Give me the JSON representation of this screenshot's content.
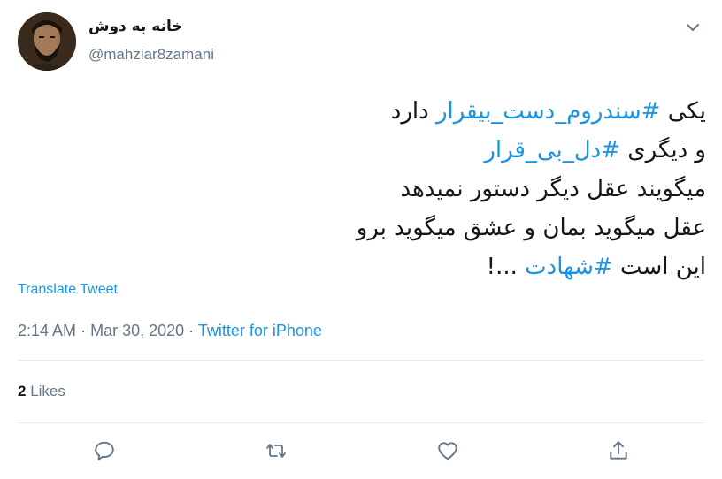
{
  "user": {
    "display_name": "خانه به دوش",
    "handle": "@mahziar8zamani"
  },
  "tweet": {
    "lines": [
      {
        "parts": [
          {
            "text": "یکی ",
            "type": "text"
          },
          {
            "text": "#سندروم_دست_بیقرار",
            "type": "hashtag"
          },
          {
            "text": " دارد",
            "type": "text"
          }
        ]
      },
      {
        "parts": [
          {
            "text": "و دیگری ",
            "type": "text"
          },
          {
            "text": "#دل_بی_قرار",
            "type": "hashtag"
          }
        ]
      },
      {
        "parts": [
          {
            "text": "میگویند عقل دیگر دستور نمیدهد",
            "type": "text"
          }
        ]
      },
      {
        "parts": [
          {
            "text": "عقل میگوید بمان و عشق میگوید برو",
            "type": "text"
          }
        ]
      },
      {
        "parts": [
          {
            "text": "این است ",
            "type": "text"
          },
          {
            "text": "#شهادت",
            "type": "hashtag"
          },
          {
            "text": " ...!",
            "type": "text"
          }
        ]
      }
    ],
    "translate_label": "Translate Tweet",
    "time": "2:14 AM",
    "separator": "·",
    "date": "Mar 30, 2020",
    "source": "Twitter for iPhone",
    "likes_count": "2",
    "likes_label": "Likes"
  },
  "icons": {
    "caret": "chevron-down-icon",
    "reply": "reply-icon",
    "retweet": "retweet-icon",
    "like": "heart-icon",
    "share": "share-icon"
  },
  "colors": {
    "link": "#1b95e0",
    "secondary_text": "#657786",
    "primary_text": "#14171a",
    "divider": "#e6ecf0"
  }
}
